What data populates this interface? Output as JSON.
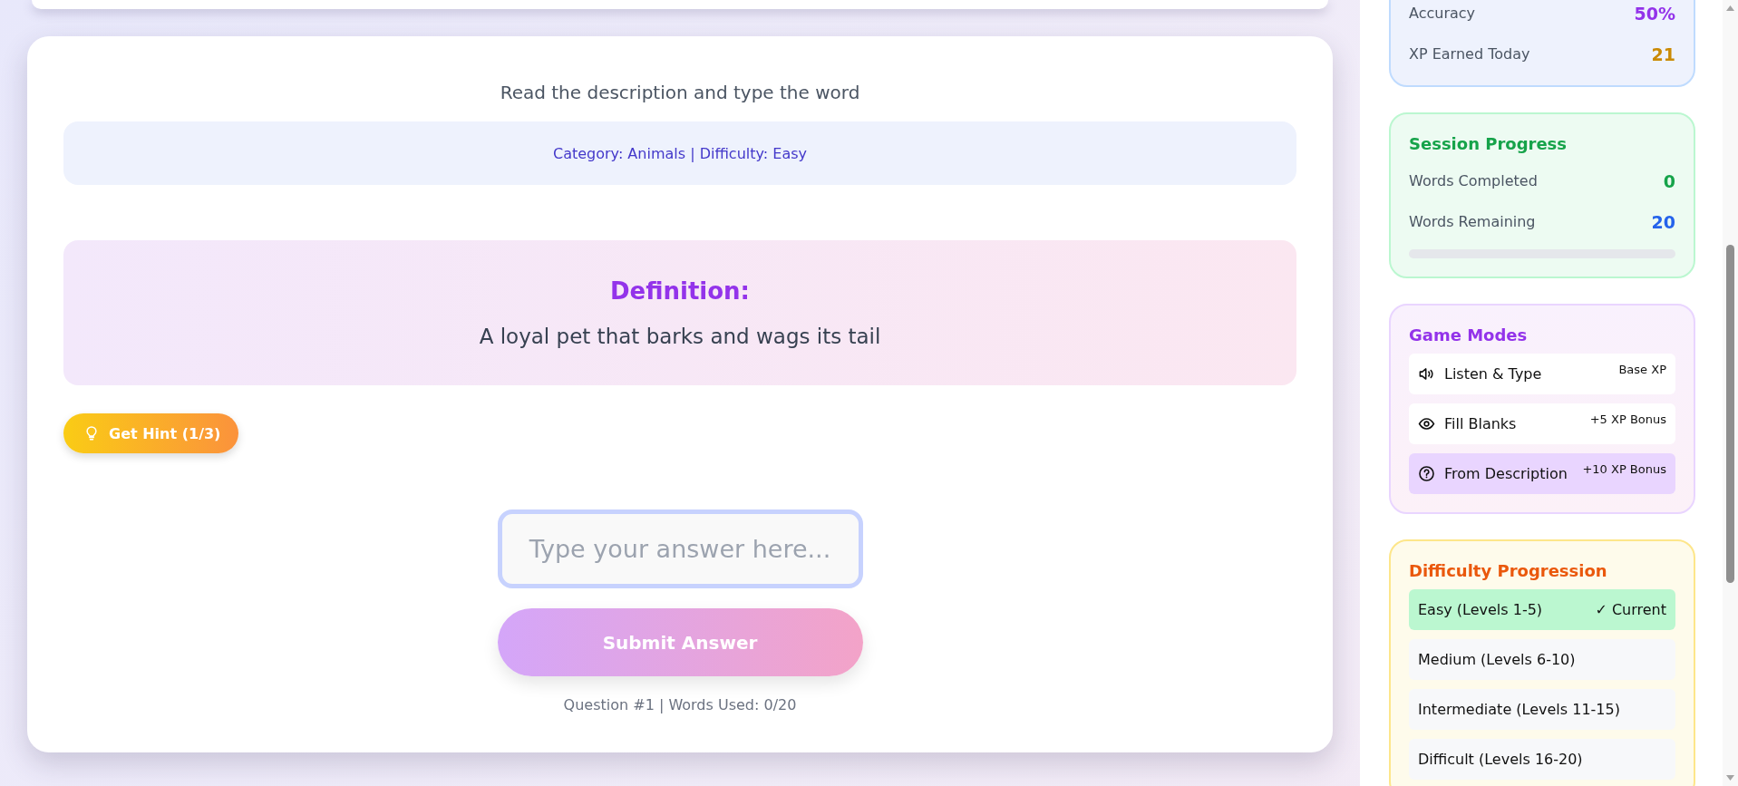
{
  "quiz": {
    "instruction": "Read the description and type the word",
    "meta": "Category: Animals | Difficulty: Easy",
    "definition_title": "Definition:",
    "definition": "A loyal pet that barks and wags its tail",
    "hint_button": "Get Hint (1/3)",
    "answer": {
      "placeholder": "Type your answer here..."
    },
    "submit_button": "Submit Answer",
    "footer": "Question #1 | Words Used: 0/20"
  },
  "stats": [
    {
      "label": "Accuracy",
      "value": "50%",
      "color": "#9333ea"
    },
    {
      "label": "XP Earned Today",
      "value": "21",
      "color": "#ca8a04"
    }
  ],
  "session": {
    "title": "Session Progress",
    "rows": [
      {
        "label": "Words Completed",
        "value": "0",
        "color": "#16a34a"
      },
      {
        "label": "Words Remaining",
        "value": "20",
        "color": "#2563eb"
      }
    ]
  },
  "game_modes": {
    "title": "Game Modes",
    "items": [
      {
        "kind": "listen",
        "label": "Listen & Type",
        "bonus": "Base XP",
        "selected": false
      },
      {
        "kind": "blanks",
        "label": "Fill Blanks",
        "bonus": "+5 XP Bonus",
        "selected": false
      },
      {
        "kind": "description",
        "label": "From Description",
        "bonus": "+10 XP Bonus",
        "selected": true
      }
    ]
  },
  "difficulty": {
    "title": "Difficulty Progression",
    "items": [
      {
        "label": "Easy (Levels 1-5)",
        "current": true,
        "badge": "✓ Current"
      },
      {
        "label": "Medium (Levels 6-10)",
        "current": false
      },
      {
        "label": "Intermediate (Levels 11-15)",
        "current": false
      },
      {
        "label": "Difficult (Levels 16-20)",
        "current": false
      }
    ]
  }
}
